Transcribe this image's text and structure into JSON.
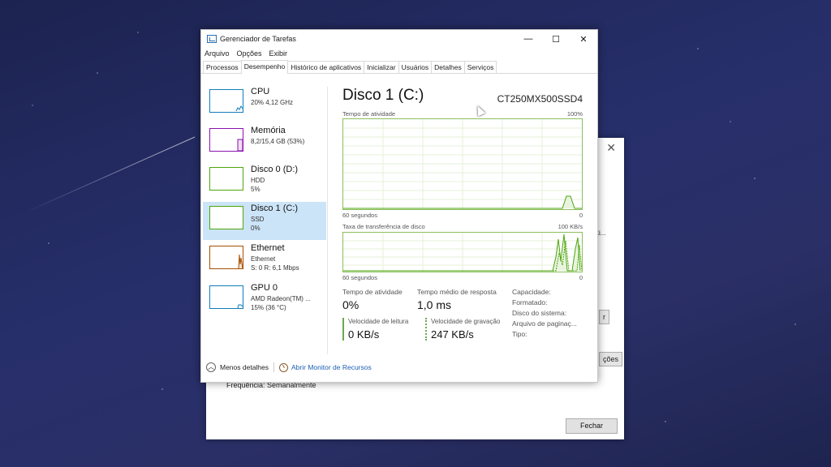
{
  "window": {
    "title": "Gerenciador de Tarefas",
    "controls": [
      "—",
      "☐",
      "✕"
    ]
  },
  "menu": [
    "Arquivo",
    "Opções",
    "Exibir"
  ],
  "tabs": [
    "Processos",
    "Desempenho",
    "Histórico de aplicativos",
    "Inicializar",
    "Usuários",
    "Detalhes",
    "Serviços"
  ],
  "sidebar": {
    "items": [
      {
        "name": "CPU",
        "l2": "20% 4,12 GHz",
        "l3": "",
        "color": "#117dbb"
      },
      {
        "name": "Memória",
        "l2": "8,2/15,4 GB (53%)",
        "l3": "",
        "color": "#8b12ae"
      },
      {
        "name": "Disco 0 (D:)",
        "l2": "HDD",
        "l3": "5%",
        "color": "#4da60c"
      },
      {
        "name": "Disco 1 (C:)",
        "l2": "SSD",
        "l3": "0%",
        "color": "#4da60c"
      },
      {
        "name": "Ethernet",
        "l2": "Ethernet",
        "l3": "S: 0 R: 6,1 Mbps",
        "color": "#a74f01"
      },
      {
        "name": "GPU 0",
        "l2": "AMD Radeon(TM) ...",
        "l3": "15% (36 °C)",
        "color": "#117dbb"
      }
    ]
  },
  "main": {
    "title": "Disco 1 (C:)",
    "model": "CT250MX500SSD4",
    "graph1": {
      "label": "Tempo de atividade",
      "max": "100%",
      "xleft": "60 segundos",
      "xright": "0"
    },
    "graph2": {
      "label": "Taxa de transferência de disco",
      "max": "100 KB/s",
      "xleft": "60 segundos",
      "xright": "0"
    },
    "stats": {
      "active_label": "Tempo de atividade",
      "active_value": "0%",
      "response_label": "Tempo médio de resposta",
      "response_value": "1,0 ms",
      "read_label": "Velocidade de leitura",
      "read_value": "0 KB/s",
      "write_label": "Velocidade de gravação",
      "write_value": "247 KB/s"
    },
    "props": [
      "Capacidade:",
      "Formatado:",
      "Disco do sistema:",
      "Arquivo de paginaç...",
      "Tipo:"
    ]
  },
  "footer": {
    "less_details": "Menos detalhes",
    "open_monitor": "Abrir Monitor de Recursos"
  },
  "back_dialog": {
    "close": "✕",
    "frequency": "Frequência: Semanalmente",
    "close_button": "Fechar",
    "btn_fragment_1": "r",
    "btn_fragment_2": "ções",
    "text_fragment": "lti..."
  }
}
